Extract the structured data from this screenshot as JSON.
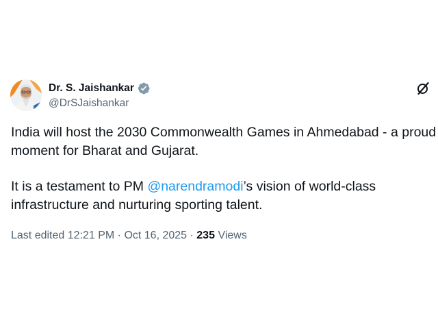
{
  "author": {
    "display_name": "Dr. S. Jaishankar",
    "handle": "@DrSJaishankar",
    "verified_icon": "verified-badge-icon"
  },
  "tweet": {
    "para1_line1": "India will host the 2030 Commonwealth Games in Ahmedabad - a proud",
    "para1_line2": "moment for Bharat and Gujarat.",
    "para2_prefix": "It is a testament to PM ",
    "para2_mention": "@narendramodi",
    "para2_suffix": "’s vision of world-class",
    "para2_line2": "infrastructure and nurturing sporting talent."
  },
  "meta": {
    "edited_label": "Last edited",
    "time": "12:21 PM",
    "separator": " · ",
    "date": "Oct 16, 2025",
    "views_count": "235",
    "views_label": "Views"
  },
  "colors": {
    "accent": "#1d9bf0",
    "secondary_text": "#536471",
    "primary_text": "#0f1419"
  }
}
